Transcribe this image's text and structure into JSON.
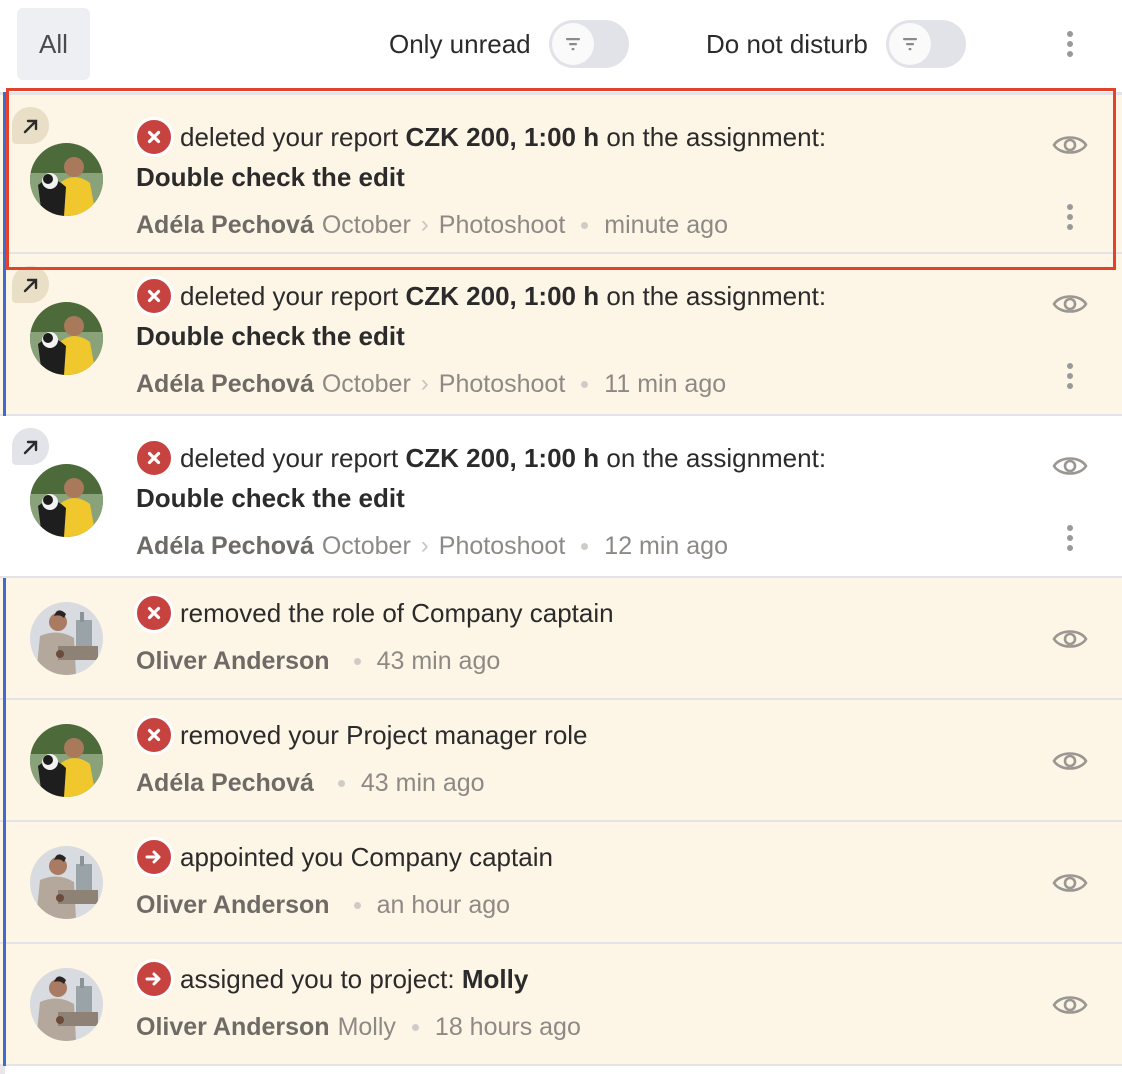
{
  "header": {
    "tab_all": "All",
    "only_unread_label": "Only unread",
    "do_not_disturb_label": "Do not disturb",
    "only_unread_enabled": false,
    "do_not_disturb_enabled": false
  },
  "colors": {
    "unread_bg": "#fdf5e6",
    "unread_marker": "#3f6bd0",
    "status_red": "#c64340",
    "selection_outline": "#e2432a"
  },
  "notifications": [
    {
      "status": "removed",
      "unread": true,
      "text_pre": "deleted your report",
      "text_bold": "CZK 200, 1:00 h",
      "text_post": "on the assignment:",
      "subject": "Double check the edit",
      "author": "Adéla Pechová",
      "crumb1": "October",
      "crumb2": "Photoshoot",
      "time": "minute ago",
      "avatar": "adela",
      "selected": true
    },
    {
      "status": "removed",
      "unread": true,
      "text_pre": "deleted your report",
      "text_bold": "CZK 200, 1:00 h",
      "text_post": "on the assignment:",
      "subject": "Double check the edit",
      "author": "Adéla Pechová",
      "crumb1": "October",
      "crumb2": "Photoshoot",
      "time": "11 min ago",
      "avatar": "adela"
    },
    {
      "status": "removed",
      "unread": false,
      "text_pre": "deleted your report",
      "text_bold": "CZK 200, 1:00 h",
      "text_post": "on the assignment:",
      "subject": "Double check the edit",
      "author": "Adéla Pechová",
      "crumb1": "October",
      "crumb2": "Photoshoot",
      "time": "12 min ago",
      "avatar": "adela"
    },
    {
      "status": "removed",
      "unread": true,
      "text_pre": "removed the role of Company captain",
      "author": "Oliver Anderson",
      "time": "43 min ago",
      "avatar": "oliver"
    },
    {
      "status": "removed",
      "unread": true,
      "text_pre": "removed your Project manager role",
      "author": "Adéla Pechová",
      "time": "43 min ago",
      "avatar": "adela"
    },
    {
      "status": "assigned",
      "unread": true,
      "text_pre": "appointed you Company captain",
      "author": "Oliver Anderson",
      "time": "an hour ago",
      "avatar": "oliver"
    },
    {
      "status": "assigned",
      "unread": true,
      "text_pre": "assigned you to project:",
      "text_bold": "Molly",
      "author": "Oliver Anderson",
      "crumb1": "Molly",
      "time": "18 hours ago",
      "avatar": "oliver"
    }
  ]
}
